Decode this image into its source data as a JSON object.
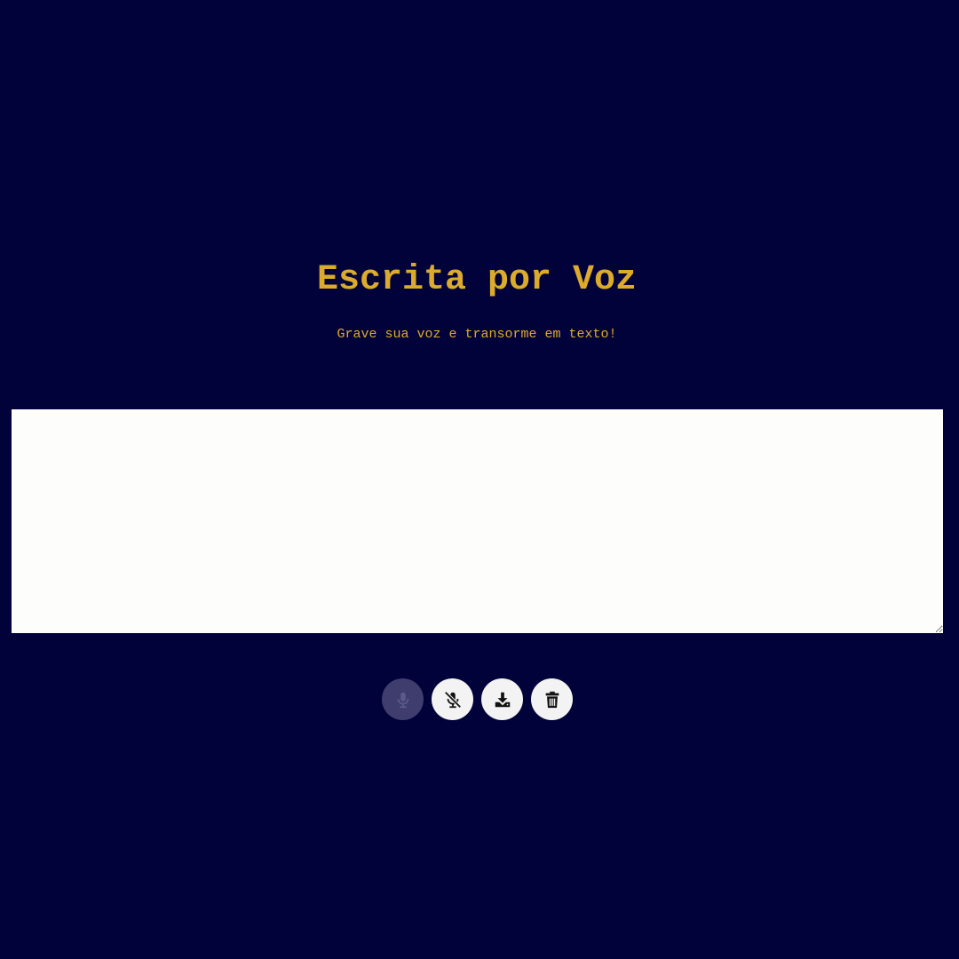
{
  "header": {
    "title": "Escrita por Voz",
    "subtitle": "Grave sua voz e transorme em texto!"
  },
  "editor": {
    "value": ""
  },
  "controls": {
    "buttons": [
      {
        "name": "record-button",
        "icon": "microphone-icon",
        "state": "disabled"
      },
      {
        "name": "stop-button",
        "icon": "microphone-slash-icon",
        "state": "enabled"
      },
      {
        "name": "download-button",
        "icon": "download-icon",
        "state": "enabled"
      },
      {
        "name": "clear-button",
        "icon": "trash-icon",
        "state": "enabled"
      }
    ]
  },
  "colors": {
    "background": "#02023a",
    "accent": "#dcab2c",
    "editor_background": "#fdfdfb",
    "button_background": "#f3f3f3",
    "button_disabled_background": "#3f3c6e",
    "icon": "#111111"
  }
}
